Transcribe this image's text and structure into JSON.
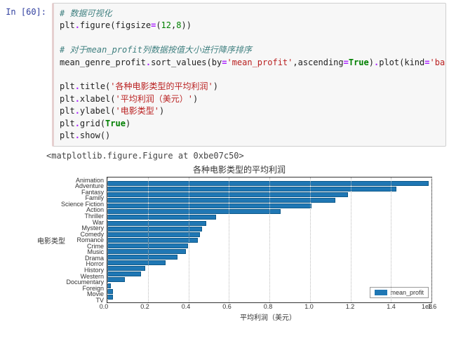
{
  "prompt": "In [60]:",
  "code": {
    "l1": "# 数据可视化",
    "l2a": "plt",
    "l2b": ".",
    "l2c": "figure(figsize",
    "l2d": "=",
    "l2e": "(",
    "l2f": "12",
    "l2g": ",",
    "l2h": "8",
    "l2i": "))",
    "l3": "# 对于mean_profit列数据按值大小进行降序排序",
    "l4a": "mean_genre_profit",
    "l4b": ".",
    "l4c": "sort_values(by",
    "l4d": "=",
    "l4e": "'mean_profit'",
    "l4f": ",ascending",
    "l4g": "=",
    "l4h": "True",
    "l4i": ")",
    "l4j": ".",
    "l4k": "plot(kind",
    "l4l": "=",
    "l4m": "'barh'",
    "l4n": ")",
    "l5a": "plt",
    "l5b": ".",
    "l5c": "title(",
    "l5d": "'各种电影类型的平均利润'",
    "l5e": ")",
    "l6a": "plt",
    "l6b": ".",
    "l6c": "xlabel(",
    "l6d": "'平均利润（美元）'",
    "l6e": ")",
    "l7a": "plt",
    "l7b": ".",
    "l7c": "ylabel(",
    "l7d": "'电影类型'",
    "l7e": ")",
    "l8a": "plt",
    "l8b": ".",
    "l8c": "grid(",
    "l8d": "True",
    "l8e": ")",
    "l9a": "plt",
    "l9b": ".",
    "l9c": "show()"
  },
  "output_repr": "<matplotlib.figure.Figure at 0xbe07c50>",
  "chart_data": {
    "type": "bar",
    "orientation": "horizontal",
    "title": "各种电影类型的平均利润",
    "xlabel": "平均利润（美元）",
    "ylabel": "电影类型",
    "xlim": [
      0.0,
      1.6
    ],
    "x_scale_note": "1e8",
    "xticks": [
      "0.0",
      "0.2",
      "0.4",
      "0.6",
      "0.8",
      "1.0",
      "1.2",
      "1.4",
      "1.6"
    ],
    "categories": [
      "Animation",
      "Adventure",
      "Fantasy",
      "Family",
      "Science Fiction",
      "Action",
      "Thriller",
      "War",
      "Mystery",
      "Comedy",
      "Romance",
      "Crime",
      "Music",
      "Drama",
      "Horror",
      "History",
      "Western",
      "Documentary",
      "Foreign",
      "Movie",
      "TV"
    ],
    "values": [
      1.58,
      1.42,
      1.18,
      1.12,
      1.0,
      0.85,
      0.53,
      0.48,
      0.46,
      0.45,
      0.44,
      0.39,
      0.38,
      0.34,
      0.28,
      0.18,
      0.16,
      0.08,
      0.01,
      0.02,
      0.02
    ],
    "legend": "mean_profit"
  }
}
